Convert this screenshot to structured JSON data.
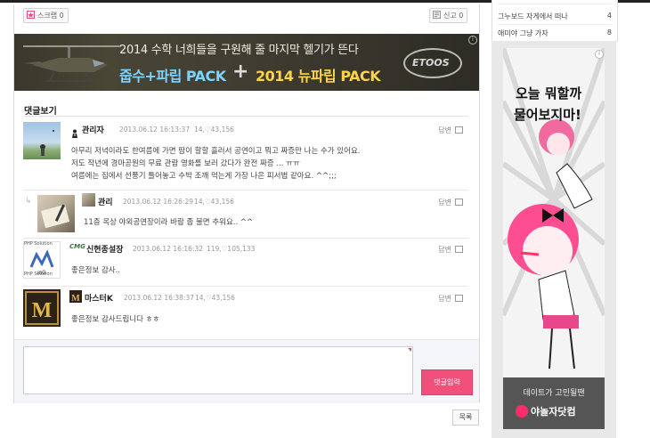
{
  "post_actions": {
    "scrap_label": "스크랩 0",
    "report_label": "신고 0"
  },
  "banner": {
    "headline": "2014 수학 너희들을 구원해 줄 마지막 헬기가 뜬다",
    "product_a": "줍수+파립 PACK",
    "plus": "+",
    "product_b": "2014 뉴파립 PACK",
    "brand": "ETOOS",
    "ad_badge": "i"
  },
  "comments_section": {
    "title": "댓글보기",
    "reply_label": "답변",
    "items": [
      {
        "nick": "관리자",
        "time": "2013.06.12 16:13:37",
        "stats": "14,♡43,156",
        "lines": [
          "아무리 저녁이라도 한여름에 가면 땀이 할할 흘러서 공연이고 뭐고 짜증만 나는 수가 있어요.",
          "저도 작년에 경마공원의 무료 관람 영화를 보러 갔다가 완전 짜증 ... ㅠㅠ",
          "여름에는 집에서 선풍기 틀어놓고 수박 조깨 먹는게 가장 나은 피서법 같아요. ^^;;;"
        ]
      },
      {
        "nick": "관리",
        "time": "2013.06.12 16:26:29",
        "stats": "14,♡43,156",
        "lines": [
          "11층 옥상 야외공연장이라 바람 좀 불면 추워요.. ^^"
        ]
      },
      {
        "nick": "신현종설장",
        "nick_prefix": "CMG",
        "time": "2013.06.12 16:16:32",
        "stats": "119,♡105,133",
        "lines": [
          "좋은정보 감사.."
        ],
        "avatar_text": "PHP Solution"
      },
      {
        "nick": "마스터K",
        "time": "2013.06.12 16:38:37",
        "stats": "14,♡43,156",
        "lines": [
          "좋은정보 감사드립니다 ㅎㅎ"
        ]
      }
    ]
  },
  "comment_form": {
    "submit_label": "댓글입력"
  },
  "list_button": "목록",
  "sidebar": {
    "recent": [
      {
        "title": "그누보드 자게에서 떠나",
        "count": "4"
      },
      {
        "title": "애미야 그냥 가자",
        "count": "8"
      }
    ],
    "ad": {
      "line1": "오늘 뭐할까",
      "line2": "물어보지마!",
      "tagline": "데이트가 고민될땐",
      "brand": "야놀자닷컴",
      "badge": "i"
    }
  },
  "colors": {
    "accent": "#f0507a",
    "form_bg": "#f3f5f8"
  }
}
